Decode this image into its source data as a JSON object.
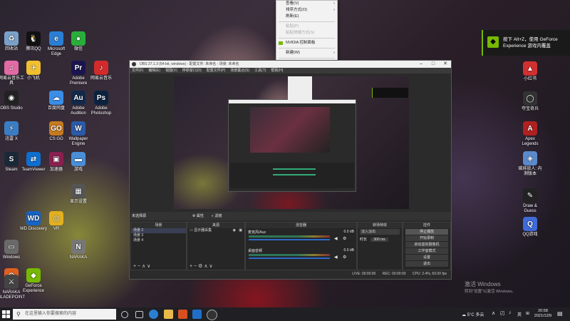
{
  "desktop": {
    "left_icons": [
      {
        "label": "回收站",
        "icon": "recycle-bin-icon",
        "color": "#7aa2c8",
        "glyph": "♻"
      },
      {
        "label": "腾讯QQ",
        "icon": "qq-icon",
        "color": "#111111",
        "glyph": "🐧"
      },
      {
        "label": "Microsoft Edge",
        "icon": "edge-icon",
        "color": "#2a7fd4",
        "glyph": "e"
      },
      {
        "label": "微信",
        "icon": "wechat-icon",
        "color": "#2aae3b",
        "glyph": "●"
      },
      {
        "label": "网易云音乐工具",
        "icon": "pink-app-icon",
        "color": "#e26aa5",
        "glyph": "♫"
      },
      {
        "label": "小飞机",
        "icon": "app-icon",
        "color": "#f0c030",
        "glyph": "✈"
      },
      {
        "label": "Adobe Premiere",
        "icon": "premiere-icon",
        "color": "#1a1450",
        "glyph": "Pr"
      },
      {
        "label": "网易云音乐",
        "icon": "netease-music-icon",
        "color": "#d32b2b",
        "glyph": "♪"
      },
      {
        "label": "OBS Studio",
        "icon": "obs-icon",
        "color": "#222222",
        "glyph": "◉"
      },
      {
        "label": "百度网盘",
        "icon": "cloud-icon",
        "color": "#3a8ee6",
        "glyph": "☁"
      },
      {
        "label": "Adobe Audition",
        "icon": "audition-icon",
        "color": "#13294a",
        "glyph": "Au"
      },
      {
        "label": "Adobe Photoshop",
        "icon": "photoshop-icon",
        "color": "#0c2340",
        "glyph": "Ps"
      },
      {
        "label": "迅雷 X",
        "icon": "thunder-icon",
        "color": "#3b7dc4",
        "glyph": "⚡"
      },
      {
        "label": "CS:GO",
        "icon": "csgo-icon",
        "color": "#c77a1f",
        "glyph": "GO"
      },
      {
        "label": "Wallpaper Engine",
        "icon": "wallpaper-icon",
        "color": "#2b5aa8",
        "glyph": "W"
      },
      {
        "label": "Steam",
        "icon": "steam-icon",
        "color": "#1b2838",
        "glyph": "S"
      },
      {
        "label": "TeamViewer",
        "icon": "teamviewer-icon",
        "color": "#0e6fd0",
        "glyph": "⇄"
      },
      {
        "label": "加速器",
        "icon": "accelerator-icon",
        "color": "#8a2050",
        "glyph": "▣"
      },
      {
        "label": "游戏",
        "icon": "folder-icon",
        "color": "#4a8fd8",
        "glyph": "▬"
      },
      {
        "label": "显示设置",
        "icon": "display-icon",
        "color": "#555555",
        "glyph": "▦"
      },
      {
        "label": "WD Discovery",
        "icon": "wd-icon",
        "color": "#1763c6",
        "glyph": "WD"
      },
      {
        "label": "VR",
        "icon": "vr-icon",
        "color": "#e2b020",
        "glyph": "◎"
      },
      {
        "label": "Windows",
        "icon": "window-icon",
        "color": "#6a6a6a",
        "glyph": "▭"
      },
      {
        "label": "NARAKA",
        "icon": "naraka-icon",
        "color": "#777777",
        "glyph": "N"
      },
      {
        "label": "GeForce Experience",
        "icon": "geforce-icon",
        "color": "#76b900",
        "glyph": "◆"
      },
      {
        "label": "设置",
        "icon": "settings-app-icon",
        "color": "#e06020",
        "glyph": "⚙"
      },
      {
        "label": "NARAKA BLADEPOINT",
        "icon": "naraka-bladepoint-icon",
        "color": "#444444",
        "glyph": "⚔"
      }
    ],
    "right_icons": [
      {
        "label": "小红书",
        "icon": "red-app-icon",
        "color": "#d03030",
        "glyph": "▲"
      },
      {
        "label": "夺宝奇兵",
        "icon": "ring-icon",
        "color": "#333333",
        "glyph": "◯"
      },
      {
        "label": "Apex Legends",
        "icon": "apex-icon",
        "color": "#b02020",
        "glyph": "A"
      },
      {
        "label": "碳排放人: 内测版本",
        "icon": "game-icon",
        "color": "#5a8acb",
        "glyph": "◈"
      },
      {
        "label": "Draw & Guess",
        "icon": "draw-guess-icon",
        "color": "#222222",
        "glyph": "✎"
      },
      {
        "label": "QQ游戏",
        "icon": "qq-game-icon",
        "color": "#3f6ad8",
        "glyph": "Q"
      }
    ]
  },
  "context_menu": {
    "items": [
      {
        "label": "查看(V)",
        "sub": true,
        "disabled": false
      },
      {
        "label": "排序方式(O)",
        "sub": true,
        "disabled": false
      },
      {
        "label": "刷新(E)",
        "sub": false,
        "disabled": false
      },
      {
        "sep": true
      },
      {
        "label": "粘贴(P)",
        "sub": false,
        "disabled": true
      },
      {
        "label": "粘贴快捷方式(S)",
        "sub": false,
        "disabled": true
      },
      {
        "sep": true
      },
      {
        "label": "NVIDIA 控制面板",
        "sub": false,
        "disabled": false,
        "icon": "nvidia-icon"
      },
      {
        "sep": true
      },
      {
        "label": "新建(W)",
        "sub": true,
        "disabled": false
      },
      {
        "sep": true
      },
      {
        "label": "显示设置(D)",
        "sub": false,
        "disabled": false,
        "icon": "display-settings-icon"
      },
      {
        "label": "个性化(R)",
        "sub": false,
        "disabled": false,
        "icon": "personalize-icon"
      }
    ]
  },
  "notification": {
    "text_line1": "按下 Alt+Z，使用 GeForce",
    "text_line2": "Experience 游戏内覆盖"
  },
  "obs": {
    "title": "OBS 27.1.3 (64-bit, windows) - 配置文件: 未命名 - 场景: 未命名",
    "menu": [
      "文件(F)",
      "编辑(E)",
      "视图(V)",
      "停靠窗口(D)",
      "配置文件(P)",
      "场景集合(S)",
      "工具(T)",
      "帮助(H)"
    ],
    "no_source": "未选择源",
    "btn_properties": "属性",
    "btn_filters": "滤镜",
    "panels": {
      "scenes": "场景",
      "sources": "来源",
      "mixer": "混音器",
      "transitions": "转场特效",
      "controls": "控件"
    },
    "scenes": [
      "场景 2",
      "场景 3",
      "场景 4"
    ],
    "sources": [
      "显示器采集"
    ],
    "mixer": [
      {
        "name": "麦克风/Aux",
        "db": "0.0 dB"
      },
      {
        "name": "桌面音频",
        "db": "0.0 dB"
      }
    ],
    "transition": {
      "value": "淡入淡出",
      "duration_label": "时长",
      "duration": "300 ms"
    },
    "controls": [
      "停止播放",
      "开始录制",
      "启动虚拟摄像机",
      "工作室模式",
      "设置",
      "退出"
    ],
    "status": {
      "live": "LIVE: 00:00:00",
      "rec": "REC: 00:00:00",
      "cpu": "CPU: 2.4%, 60.00 fps"
    }
  },
  "watermark": {
    "line1": "激活 Windows",
    "line2": "转到\"设置\"以激活 Windows。"
  },
  "taskbar": {
    "search_placeholder": "在这里输入你要搜索的内容",
    "temperature": "5°C",
    "weather": "多云",
    "lang": "英",
    "time": "20:58",
    "date": "2021/12/9"
  }
}
